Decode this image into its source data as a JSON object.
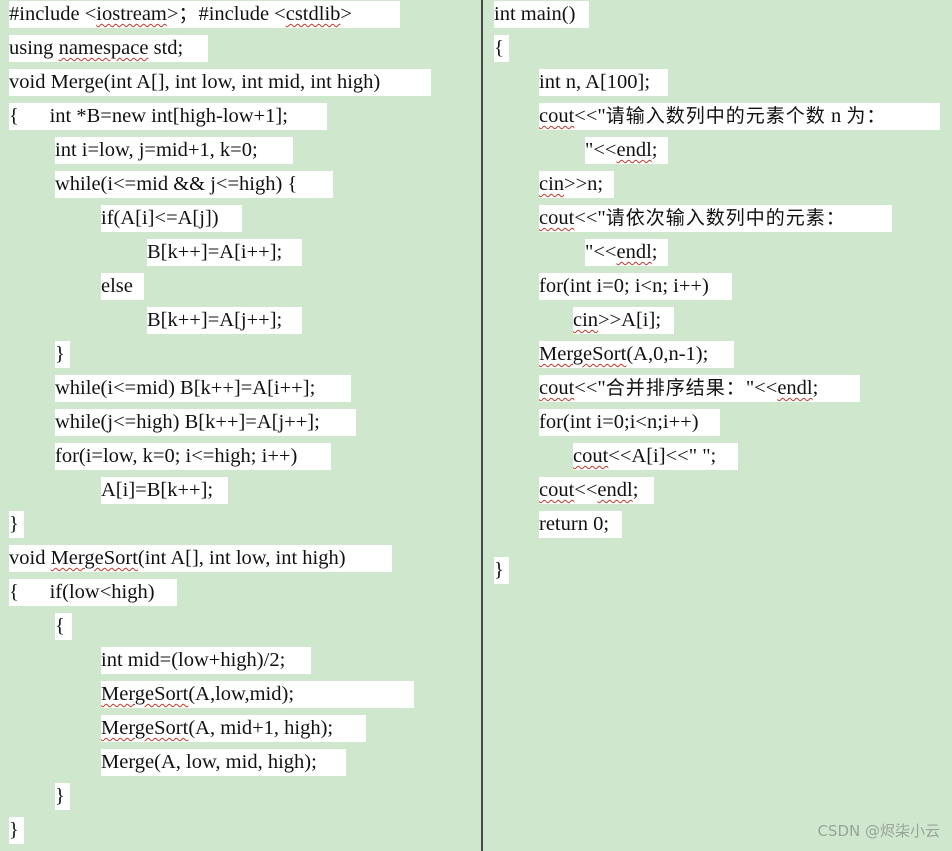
{
  "left": {
    "lines": [
      "#include <iostream>；#include <cstdlib>",
      "using namespace std;",
      "void Merge(int A[], int low, int mid, int high)",
      "{      int *B=new int[high-low+1];",
      "int i=low, j=mid+1, k=0;",
      "while(i<=mid && j<=high) {",
      "if(A[i]<=A[j])",
      "B[k++]=A[i++];",
      "else",
      "B[k++]=A[j++];",
      "}",
      "while(i<=mid) B[k++]=A[i++];",
      "while(j<=high) B[k++]=A[j++];",
      "for(i=low, k=0; i<=high; i++)",
      "A[i]=B[k++];",
      "}",
      "void MergeSort(int A[], int low, int high)",
      "{      if(low<high)",
      "{",
      "int mid=(low+high)/2;",
      "MergeSort(A,low,mid);",
      "MergeSort(A, mid+1, high);",
      "Merge(A, low, mid, high);",
      "}",
      "}"
    ]
  },
  "right": {
    "lines": [
      "int main()",
      "{",
      "int n, A[100];",
      "cout<<\"请输入数列中的元素个数 n 为：",
      "\"<<endl;",
      "cin>>n;",
      "cout<<\"请依次输入数列中的元素：",
      "\"<<endl;",
      "for(int i=0; i<n; i++)",
      "cin>>A[i];",
      "MergeSort(A,0,n-1);",
      "cout<<\"合并排序结果：\"<<endl;",
      "for(int i=0;i<n;i++)",
      "cout<<A[i]<<\" \";",
      "cout<<endl;",
      "return 0;",
      "}"
    ]
  },
  "watermark": "CSDN @烬柒小云",
  "colors": {
    "background": "#cfe8cd",
    "line_highlight": "#ffffff",
    "divider": "#4a4a4a",
    "squiggle": "#c0392b"
  }
}
